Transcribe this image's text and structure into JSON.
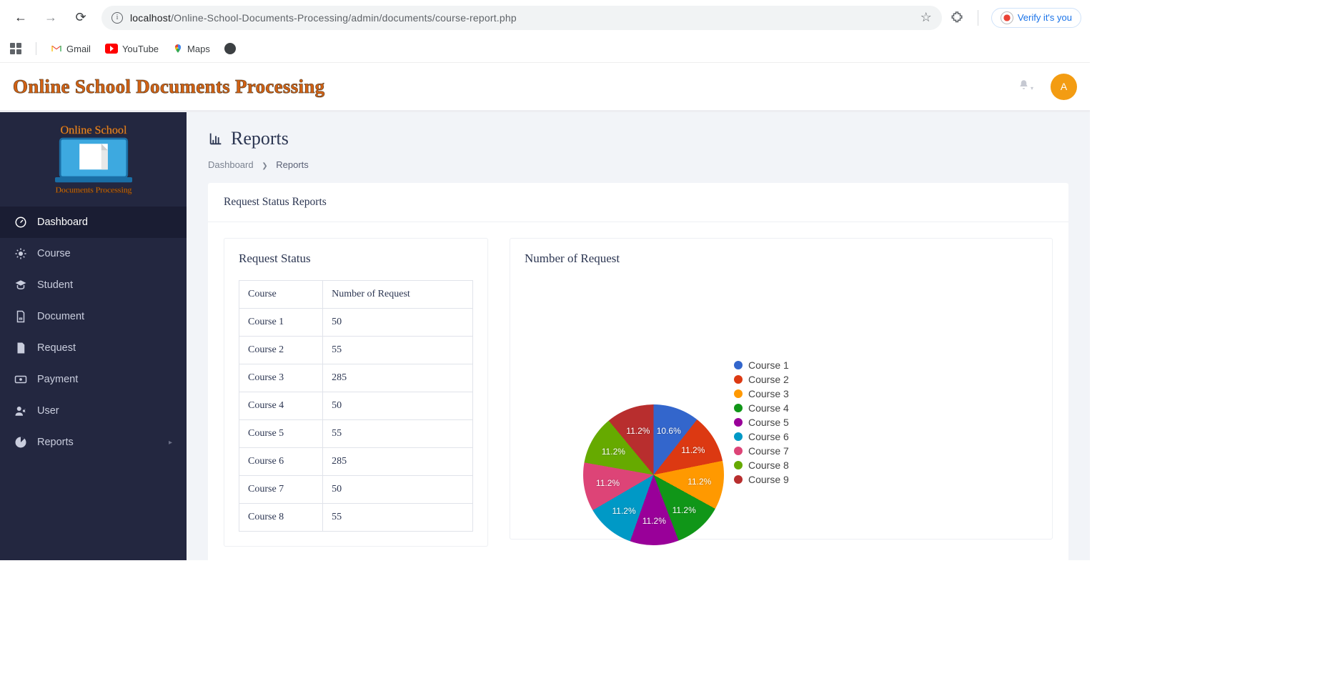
{
  "browser": {
    "url_host": "localhost",
    "url_path": "/Online-School-Documents-Processing/admin/documents/course-report.php",
    "verify_label": "Verify it's you"
  },
  "bookmarks": {
    "gmail": "Gmail",
    "youtube": "YouTube",
    "maps": "Maps"
  },
  "header": {
    "brand": "Online School Documents Processing",
    "user_initial": "A"
  },
  "sidebar": {
    "items": [
      {
        "label": "Dashboard",
        "active": true
      },
      {
        "label": "Course"
      },
      {
        "label": "Student"
      },
      {
        "label": "Document"
      },
      {
        "label": "Request"
      },
      {
        "label": "Payment"
      },
      {
        "label": "User"
      },
      {
        "label": "Reports",
        "expandable": true
      }
    ]
  },
  "page": {
    "title": "Reports",
    "crumb_root": "Dashboard",
    "crumb_current": "Reports",
    "card_title": "Request Status Reports",
    "left_panel_title": "Request Status",
    "right_panel_title": "Number of Request",
    "table": {
      "col_course": "Course",
      "col_count": "Number of Request",
      "rows": [
        {
          "course": "Course 1",
          "count": "50"
        },
        {
          "course": "Course 2",
          "count": "55"
        },
        {
          "course": "Course 3",
          "count": "285"
        },
        {
          "course": "Course 4",
          "count": "50"
        },
        {
          "course": "Course 5",
          "count": "55"
        },
        {
          "course": "Course 6",
          "count": "285"
        },
        {
          "course": "Course 7",
          "count": "50"
        },
        {
          "course": "Course 8",
          "count": "55"
        }
      ]
    }
  },
  "chart_data": {
    "type": "pie",
    "title": "Number of Request",
    "series": [
      {
        "name": "Course 1",
        "pct": 10.6,
        "color": "#3366cc"
      },
      {
        "name": "Course 2",
        "pct": 11.2,
        "color": "#dc3912"
      },
      {
        "name": "Course 3",
        "pct": 11.2,
        "color": "#ff9900"
      },
      {
        "name": "Course 4",
        "pct": 11.2,
        "color": "#109618"
      },
      {
        "name": "Course 5",
        "pct": 11.2,
        "color": "#990099"
      },
      {
        "name": "Course 6",
        "pct": 11.2,
        "color": "#0099c6"
      },
      {
        "name": "Course 7",
        "pct": 11.2,
        "color": "#dd4477"
      },
      {
        "name": "Course 8",
        "pct": 11.2,
        "color": "#66aa00"
      },
      {
        "name": "Course 9",
        "pct": 11.2,
        "color": "#b82e2e"
      }
    ],
    "legend_items": [
      "Course 1",
      "Course 2",
      "Course 3",
      "Course 4",
      "Course 5",
      "Course 6",
      "Course 7",
      "Course 8",
      "Course 9"
    ]
  }
}
